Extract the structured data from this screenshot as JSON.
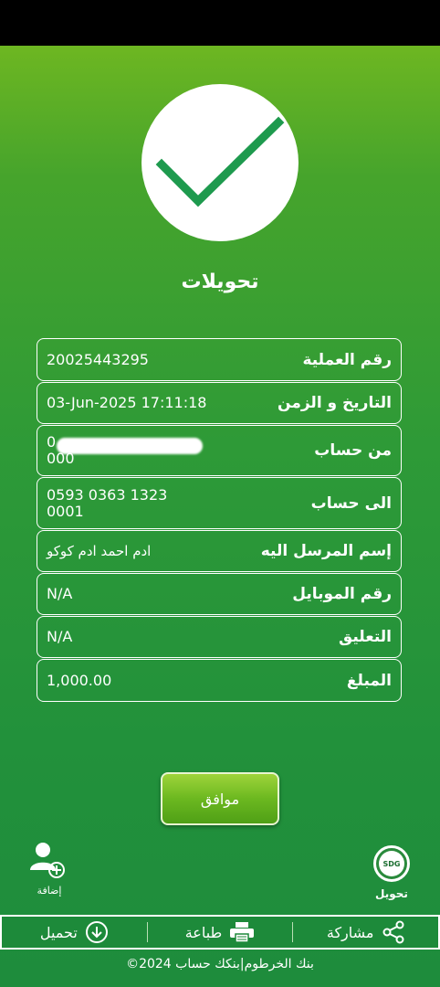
{
  "title": "تحويلات",
  "details": [
    {
      "label": "رقم العملية",
      "value": "20025443295"
    },
    {
      "label": "التاريخ و الزمن",
      "value": "03-Jun-2025 17:11:18"
    },
    {
      "label": "من حساب",
      "value": "0\n000"
    },
    {
      "label": "الى حساب",
      "value": "0593 0363 1323\n0001"
    },
    {
      "label": "إسم المرسل اليه",
      "value": "ادم احمد ادم كوكو"
    },
    {
      "label": "رقم الموبايل",
      "value": "N/A"
    },
    {
      "label": "التعليق",
      "value": "N/A"
    },
    {
      "label": "المبلغ",
      "value": "1,000.00"
    }
  ],
  "ok_button": "موافق",
  "add_label": "إضافة",
  "transfer_label": "تحويل",
  "sdg_badge": "SDG",
  "actions": {
    "download": "تحميل",
    "print": "طباعة",
    "share": "مشاركة"
  },
  "footer": "©2024 بنك الخرطوم|بنكك حساب",
  "colors": {
    "check": "#1e9a4e",
    "background": "#2e9a37",
    "button": "#6cb820"
  }
}
